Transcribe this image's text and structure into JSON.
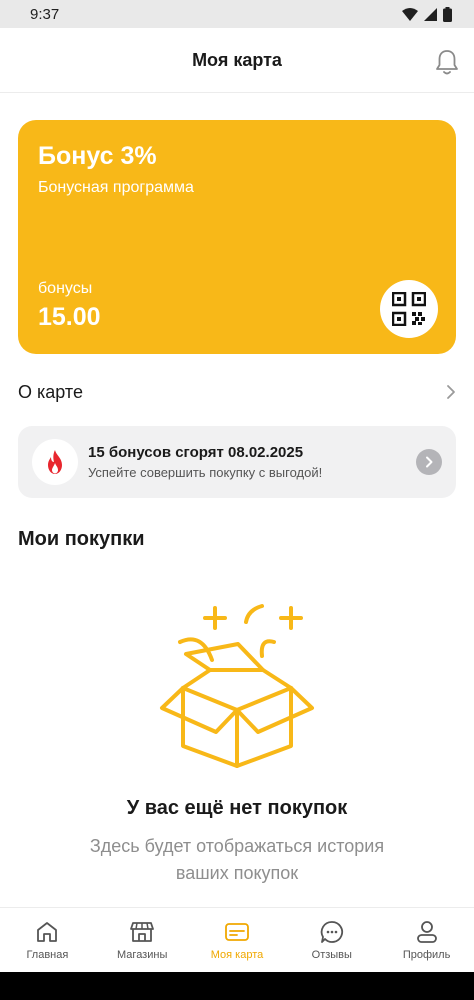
{
  "status": {
    "time": "9:37"
  },
  "header": {
    "title": "Моя карта"
  },
  "card": {
    "title": "Бонус 3%",
    "subtitle": "Бонусная программа",
    "bonus_label": "бонусы",
    "bonus_value": "15.00",
    "color": "#f8b818"
  },
  "about": {
    "label": "О карте"
  },
  "expire": {
    "title": "15 бонусов сгорят 08.02.2025",
    "subtitle": "Успейте совершить покупку с выгодой!"
  },
  "purchases": {
    "title": "Мои покупки",
    "empty_title": "У вас ещё нет покупок",
    "empty_subtitle": "Здесь будет отображаться история ваших покупок"
  },
  "tabs": [
    {
      "label": "Главная",
      "icon": "home-icon",
      "active": false
    },
    {
      "label": "Магазины",
      "icon": "store-icon",
      "active": false
    },
    {
      "label": "Моя карта",
      "icon": "card-icon",
      "active": true
    },
    {
      "label": "Отзывы",
      "icon": "chat-icon",
      "active": false
    },
    {
      "label": "Профиль",
      "icon": "profile-icon",
      "active": false
    }
  ]
}
